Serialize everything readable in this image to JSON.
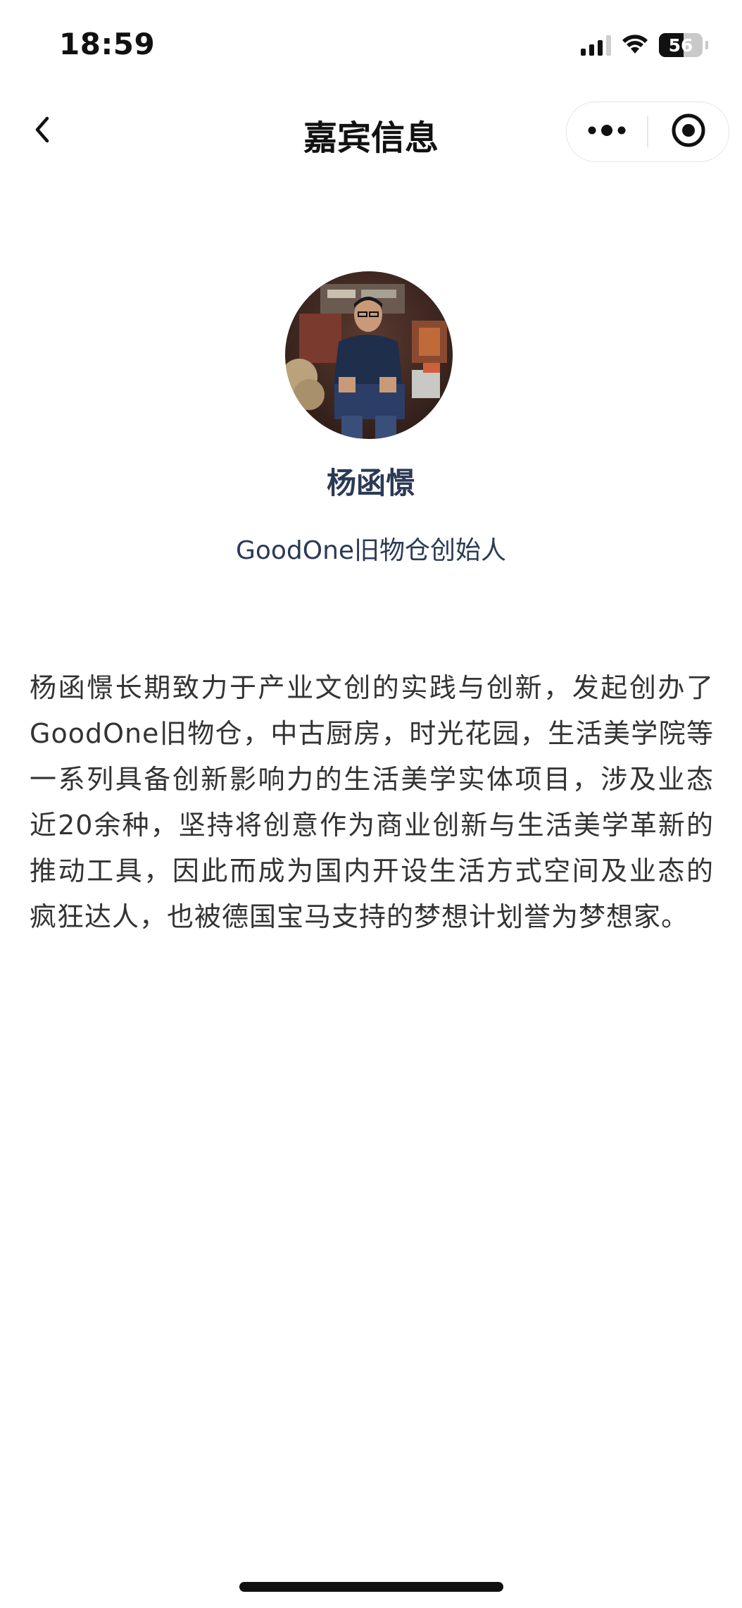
{
  "status_bar": {
    "time": "18:59",
    "battery_percent": "56",
    "battery_level": 0.56,
    "signal_bars_active": 3,
    "signal_bars_total": 4,
    "icons": [
      "signal-icon",
      "wifi-icon",
      "battery-icon"
    ]
  },
  "nav": {
    "title": "嘉宾信息",
    "back_icon": "chevron-left-icon",
    "more_icon": "more-dots-icon",
    "close_icon": "target-close-icon"
  },
  "guest": {
    "name": "杨函憬",
    "title": "GoodOne旧物仓创始人",
    "bio": "杨函憬长期致力于产业文创的实践与创新，发起创办了GoodOne旧物仓，中古厨房，时光花园，生活美学院等一系列具备创新影响力的生活美学实体项目，涉及业态近20余种，坚持将创意作为商业创新与生活美学革新的推动工具，因此而成为国内开设生活方式空间及业态的疯狂达人，也被德国宝马支持的梦想计划誉为梦想家。",
    "avatar": "guest-portrait-photo"
  },
  "colors": {
    "accent": "#2b3a55",
    "text": "#333333",
    "background": "#ffffff"
  }
}
